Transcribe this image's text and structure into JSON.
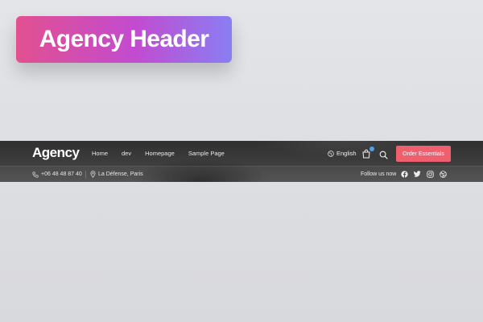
{
  "badge": {
    "title": "Agency Header"
  },
  "header": {
    "logo": "Agency",
    "nav": [
      "Home",
      "dev",
      "Homepage",
      "Sample Page"
    ],
    "language": "English",
    "order_button": "Order Essentials",
    "phone": "+06 48 48 87 40",
    "address": "La Défense, Paris",
    "follow_text": "Follow us now",
    "icons": {
      "language": "globe-icon",
      "cart": "shopping-bag-icon",
      "search": "search-icon",
      "phone": "phone-icon",
      "address": "map-pin-icon",
      "socials": [
        "facebook-icon",
        "twitter-icon",
        "instagram-icon",
        "dribbble-icon"
      ]
    },
    "colors": {
      "order_button": "#ef5f6d",
      "cart_badge": "#4aa3f0",
      "badge_gradient": [
        "#e2508f",
        "#c24bd0",
        "#8a7ef3"
      ]
    }
  }
}
